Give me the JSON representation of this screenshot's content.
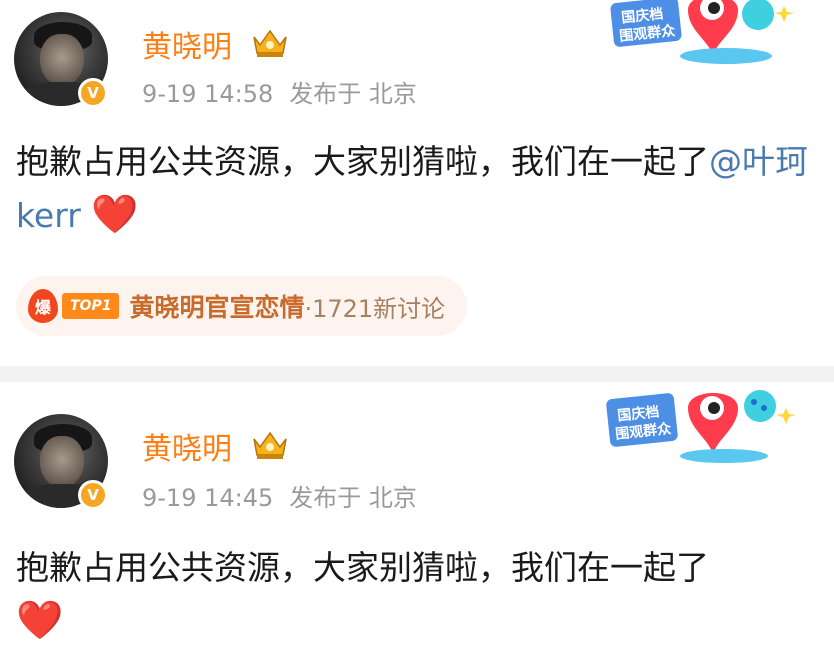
{
  "posts": [
    {
      "author": "黄晓明",
      "date": "9-19 14:58",
      "posted_from": "发布于 北京",
      "text": "抱歉占用公共资源，大家别猜啦，我们在一起了",
      "mention": "@叶珂 kerr",
      "heart": "❤️",
      "sticker_lines": [
        "国庆档",
        "围观群众"
      ],
      "topic": {
        "hot_label": "爆",
        "rank_label": "TOP1",
        "title": "黄晓明官宣恋情",
        "count": "·1721新讨论"
      }
    },
    {
      "author": "黄晓明",
      "date": "9-19 14:45",
      "posted_from": "发布于 北京",
      "text": "抱歉占用公共资源，大家别猜啦，我们在一起了",
      "heart": "❤️",
      "sticker_lines": [
        "国庆档",
        "围观群众"
      ]
    }
  ],
  "verified_badge": "V",
  "icons": {
    "crown": "crown-icon",
    "verified": "verified-v-icon",
    "hot": "hot-flame-icon"
  },
  "colors": {
    "username": "#ff7e12",
    "mention": "#4a7bb0",
    "meta": "#9a9a9a",
    "topic_bg": "#fdf4ef",
    "verified": "#f7a623"
  }
}
